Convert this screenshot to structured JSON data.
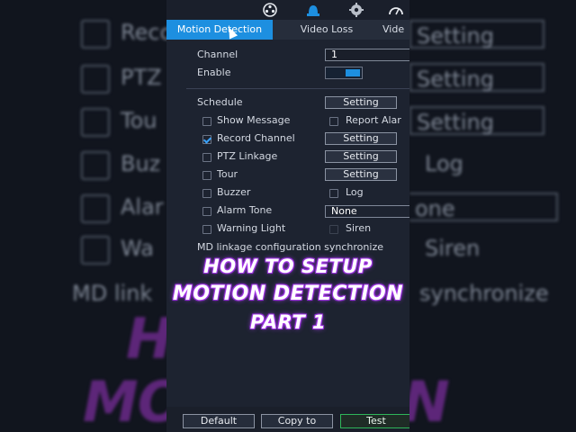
{
  "background": {
    "rows": [
      {
        "text": "Reco",
        "has_checkbox": true,
        "checked": true,
        "button": "Setting"
      },
      {
        "text": "PTZ",
        "has_checkbox": true,
        "checked": false,
        "button": "Setting"
      },
      {
        "text": "Tou",
        "has_checkbox": true,
        "checked": false,
        "button": "Setting"
      },
      {
        "text": "Buz",
        "has_checkbox": true,
        "checked": false,
        "button": "Log"
      },
      {
        "text": "Alar",
        "has_checkbox": true,
        "checked": false,
        "button": "one"
      },
      {
        "text": "Wa",
        "has_checkbox": true,
        "checked": false,
        "button": "Siren"
      }
    ],
    "md_text_left": "MD link",
    "md_text_right": "synchronize",
    "overlay_big_1": "HO    UP",
    "overlay_big_2": "MOTI    CTION"
  },
  "icons": [
    "film-reel-icon",
    "siren-alarm-icon",
    "network-gear-icon",
    "gauge-icon"
  ],
  "tabs": [
    {
      "label": "Motion Detection",
      "active": true
    },
    {
      "label": "Video Loss",
      "active": false
    },
    {
      "label": "Vide",
      "active": false
    }
  ],
  "channel": {
    "label": "Channel",
    "value": "1"
  },
  "enable": {
    "label": "Enable",
    "on": true
  },
  "schedule": {
    "label": "Schedule",
    "button": "Setting"
  },
  "options": {
    "show_message": {
      "label": "Show Message",
      "checked": false
    },
    "report_alarm": {
      "label": "Report Alar",
      "checked": false
    },
    "record_channel": {
      "label": "Record Channel",
      "checked": true,
      "button": "Setting"
    },
    "ptz_linkage": {
      "label": "PTZ Linkage",
      "checked": false,
      "button": "Setting"
    },
    "tour": {
      "label": "Tour",
      "checked": false,
      "button": "Setting"
    },
    "buzzer": {
      "label": "Buzzer",
      "checked": false
    },
    "log": {
      "label": "Log",
      "checked": false
    },
    "alarm_tone": {
      "label": "Alarm Tone",
      "checked": false,
      "select": "None"
    },
    "warning_light": {
      "label": "Warning Light",
      "checked": false
    },
    "siren": {
      "label": "Siren",
      "checked": false
    }
  },
  "md_sync_text": "MD linkage configuration synchronize",
  "overlay": {
    "line1": "HOW TO SETUP",
    "line2": "MOTION DETECTION",
    "line3": "PART 1"
  },
  "bottom": {
    "default": "Default",
    "copy_to": "Copy to",
    "test": "Test"
  },
  "colors": {
    "accent": "#1d8fe0",
    "test_border": "#2fb55a",
    "overlay_glow": "#a43cf0"
  }
}
